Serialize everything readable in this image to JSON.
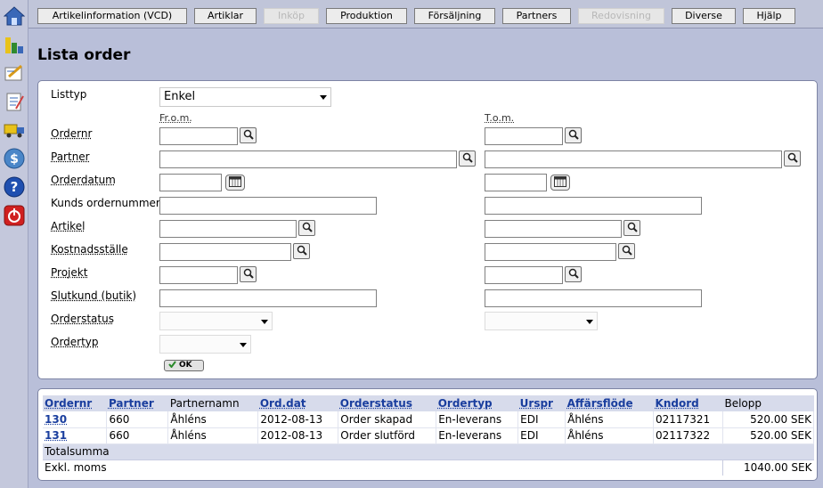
{
  "sidebar_icons": [
    "home-icon",
    "chart-icon",
    "edit-icon",
    "notepad-icon",
    "truck-icon",
    "dollar-icon",
    "help-icon",
    "power-icon"
  ],
  "tabs": [
    {
      "label": "Artikelinformation (VCD)",
      "enabled": true
    },
    {
      "label": "Artiklar",
      "enabled": true
    },
    {
      "label": "Inköp",
      "enabled": false
    },
    {
      "label": "Produktion",
      "enabled": true
    },
    {
      "label": "Försäljning",
      "enabled": true
    },
    {
      "label": "Partners",
      "enabled": true
    },
    {
      "label": "Redovisning",
      "enabled": false
    },
    {
      "label": "Diverse",
      "enabled": true
    },
    {
      "label": "Hjälp",
      "enabled": true
    }
  ],
  "page_title": "Lista order",
  "form": {
    "listtyp_label": "Listtyp",
    "listtyp_value": "Enkel",
    "from_header": "Fr.o.m.",
    "tom_header": "T.o.m.",
    "fields": {
      "ordernr": "Ordernr",
      "partner": "Partner",
      "orderdatum": "Orderdatum",
      "kunds_ordernummer": "Kunds ordernummer",
      "artikel": "Artikel",
      "kostnadsstalle": "Kostnadsställe",
      "projekt": "Projekt",
      "slutkund": "Slutkund (butik)",
      "orderstatus": "Orderstatus",
      "ordertyp": "Ordertyp"
    },
    "ok_label": "OK"
  },
  "results": {
    "columns": [
      "Ordernr",
      "Partner",
      "Partnernamn",
      "Ord.dat",
      "Orderstatus",
      "Ordertyp",
      "Urspr",
      "Affärsflöde",
      "Kndord",
      "Belopp"
    ],
    "rows": [
      {
        "ordernr": "130",
        "partner": "660",
        "partnernamn": "Åhléns",
        "orddat": "2012-08-13",
        "orderstatus": "Order skapad",
        "ordertyp": "En-leverans",
        "urspr": "EDI",
        "affarsflode": "Åhléns",
        "kndord": "02117321",
        "belopp": "520.00 SEK"
      },
      {
        "ordernr": "131",
        "partner": "660",
        "partnernamn": "Åhléns",
        "orddat": "2012-08-13",
        "orderstatus": "Order slutförd",
        "ordertyp": "En-leverans",
        "urspr": "EDI",
        "affarsflode": "Åhléns",
        "kndord": "02117322",
        "belopp": "520.00 SEK"
      }
    ],
    "total_label": "Totalsumma",
    "exkl_moms_label": "Exkl. moms",
    "exkl_moms_value": "1040.00 SEK"
  }
}
